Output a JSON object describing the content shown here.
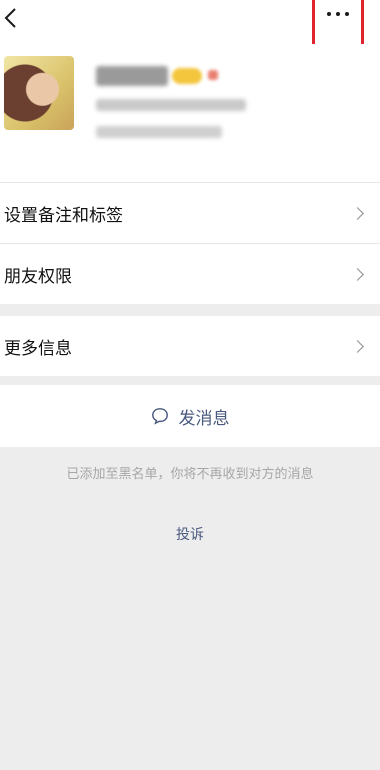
{
  "menu": [
    {
      "label": "设置备注和标签"
    },
    {
      "label": "朋友权限"
    },
    {
      "label": "更多信息"
    }
  ],
  "actions": {
    "send_message": "发消息"
  },
  "notice": "已添加至黑名单，你将不再收到对方的消息",
  "complain": "投诉",
  "icons": {
    "back": "chevron-left-icon",
    "more": "more-dots-icon",
    "chat": "chat-bubble-icon"
  },
  "colors": {
    "link": "#4a5a7e",
    "highlight": "#e0242e"
  }
}
